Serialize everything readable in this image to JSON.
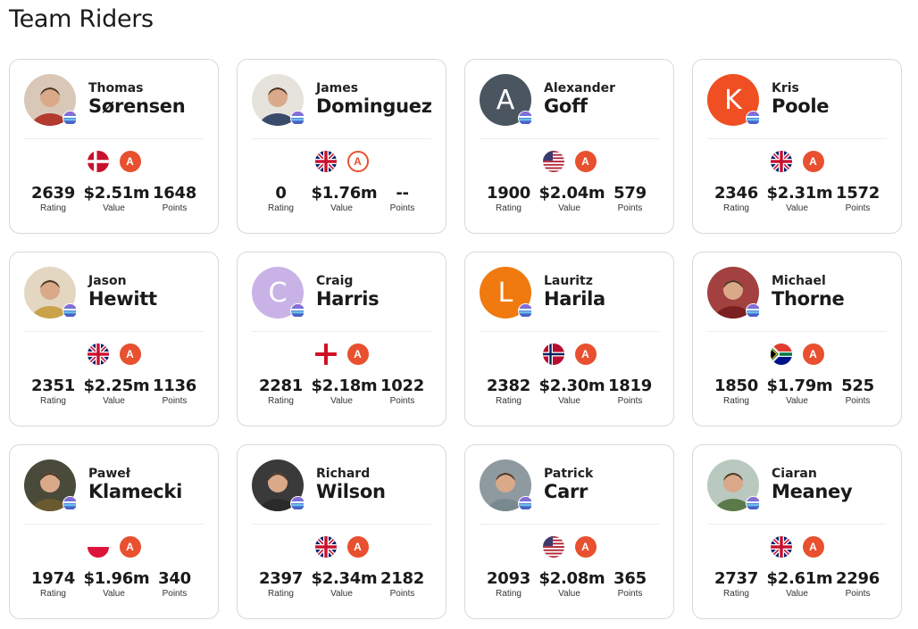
{
  "page": {
    "title": "Team Riders"
  },
  "labels": {
    "rating": "Rating",
    "value": "Value",
    "points": "Points"
  },
  "riders": [
    {
      "first": "Thomas",
      "last": "Sørensen",
      "avatar": "photo",
      "avatar_color": "#b23a2e",
      "flag": "dk",
      "category": "A",
      "category_style": "filled",
      "rating": "2639",
      "value": "$2.51m",
      "points": "1648"
    },
    {
      "first": "James",
      "last": "Dominguez",
      "avatar": "photo",
      "avatar_color": "#3a4a6a",
      "flag": "gb",
      "category": "A",
      "category_style": "outline",
      "rating": "0",
      "value": "$1.76m",
      "points": "--"
    },
    {
      "first": "Alexander",
      "last": "Goff",
      "avatar": "initial",
      "initial": "A",
      "avatar_color": "#4a5560",
      "flag": "us",
      "category": "A",
      "category_style": "filled",
      "rating": "1900",
      "value": "$2.04m",
      "points": "579"
    },
    {
      "first": "Kris",
      "last": "Poole",
      "avatar": "initial",
      "initial": "K",
      "avatar_color": "#f04e23",
      "flag": "gb",
      "category": "A",
      "category_style": "filled",
      "rating": "2346",
      "value": "$2.31m",
      "points": "1572"
    },
    {
      "first": "Jason",
      "last": "Hewitt",
      "avatar": "photo",
      "avatar_color": "#c9a24a",
      "flag": "gb",
      "category": "A",
      "category_style": "filled",
      "rating": "2351",
      "value": "$2.25m",
      "points": "1136"
    },
    {
      "first": "Craig",
      "last": "Harris",
      "avatar": "initial",
      "initial": "C",
      "avatar_color": "#c9b3e6",
      "flag": "en",
      "category": "A",
      "category_style": "filled",
      "rating": "2281",
      "value": "$2.18m",
      "points": "1022"
    },
    {
      "first": "Lauritz",
      "last": "Harila",
      "avatar": "initial",
      "initial": "L",
      "avatar_color": "#f07a10",
      "flag": "no",
      "category": "A",
      "category_style": "filled",
      "rating": "2382",
      "value": "$2.30m",
      "points": "1819"
    },
    {
      "first": "Michael",
      "last": "Thorne",
      "avatar": "photo",
      "avatar_color": "#7a2020",
      "flag": "za",
      "category": "A",
      "category_style": "filled",
      "rating": "1850",
      "value": "$1.79m",
      "points": "525"
    },
    {
      "first": "Paweł",
      "last": "Klamecki",
      "avatar": "photo",
      "avatar_color": "#6a5a30",
      "flag": "pl",
      "category": "A",
      "category_style": "filled",
      "rating": "1974",
      "value": "$1.96m",
      "points": "340"
    },
    {
      "first": "Richard",
      "last": "Wilson",
      "avatar": "photo",
      "avatar_color": "#2a2a2a",
      "flag": "gb",
      "category": "A",
      "category_style": "filled",
      "rating": "2397",
      "value": "$2.34m",
      "points": "2182"
    },
    {
      "first": "Patrick",
      "last": "Carr",
      "avatar": "photo",
      "avatar_color": "#7a8890",
      "flag": "us",
      "category": "A",
      "category_style": "filled",
      "rating": "2093",
      "value": "$2.08m",
      "points": "365"
    },
    {
      "first": "Ciaran",
      "last": "Meaney",
      "avatar": "photo",
      "avatar_color": "#5a7a4a",
      "flag": "gb",
      "category": "A",
      "category_style": "filled",
      "rating": "2737",
      "value": "$2.61m",
      "points": "2296"
    }
  ]
}
